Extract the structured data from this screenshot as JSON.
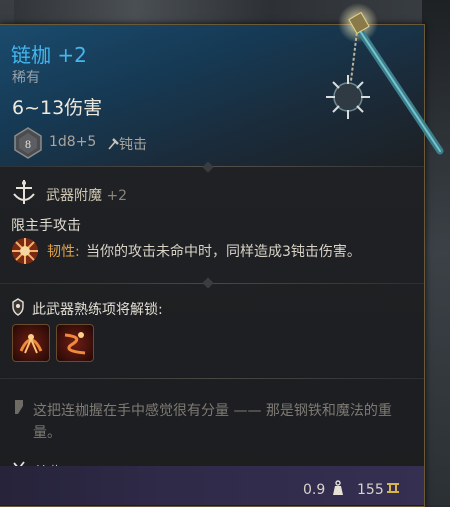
{
  "item": {
    "name": "链枷 +2",
    "rarity": "稀有",
    "damage": "6~13伤害",
    "dice_face": "8",
    "dice_formula": "1d8+5",
    "damage_type": "钝击"
  },
  "enchant": {
    "label": "武器附魔",
    "bonus": "+2",
    "restriction": "限主手攻击",
    "trait_name": "韧性:",
    "trait_desc": "当你的攻击未命中时，同样造成3钝击伤害。"
  },
  "proficiency": {
    "label": "此武器熟练项将解锁:",
    "skills": [
      "skill-1",
      "skill-2"
    ]
  },
  "flavor": "这把连枷握在手中感觉很有分量 —— 那是钢铁和魔法的重量。",
  "weapon_type": "连枷",
  "footer": {
    "weight": "0.9",
    "price": "155"
  },
  "colors": {
    "title": "#43b6ef",
    "trait": "#e0a14b",
    "footer": "#2f2a48"
  }
}
